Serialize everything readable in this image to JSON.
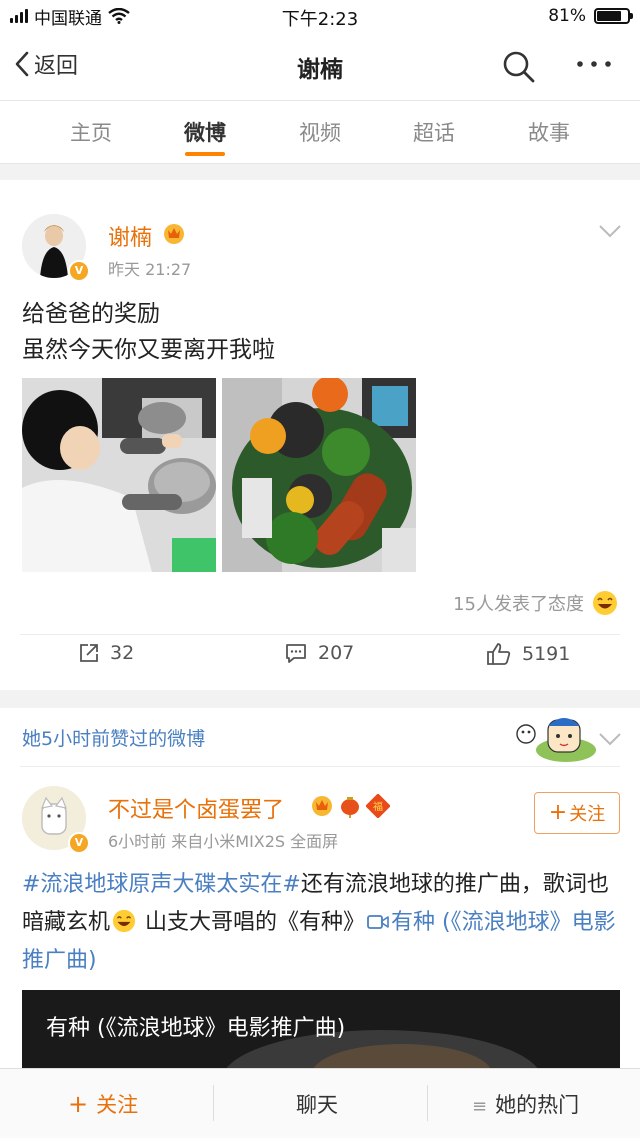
{
  "status_bar": {
    "carrier": "中国联通",
    "time": "下午2:23",
    "battery": "81%",
    "battery_level": 0.81
  },
  "nav": {
    "back_label": "返回",
    "title": "谢楠"
  },
  "tabs": [
    {
      "label": "主页"
    },
    {
      "label": "微博"
    },
    {
      "label": "视频"
    },
    {
      "label": "超话"
    },
    {
      "label": "故事"
    }
  ],
  "post1": {
    "username": "谢楠",
    "time": "昨天 21:27",
    "content_line1": "给爸爸的奖励",
    "content_line2": "虽然今天你又要离开我啦",
    "reaction_text": "15人发表了态度",
    "reposts": "32",
    "comments": "207",
    "likes": "5191"
  },
  "post2": {
    "liked_header": "她5小时前赞过的微博",
    "username": "不过是个卤蛋罢了",
    "meta": "6小时前  来自小米MIX2S 全面屏",
    "follow_label": "关注",
    "hashtag": "#流浪地球原声大碟太实在#",
    "text_a": "还有流浪地球的推广曲，歌词也暗藏玄机",
    "text_b": " 山支大哥唱的《有种》",
    "video_link": "有种 (《流浪地球》电影推广曲)",
    "video_title": "有种 (《流浪地球》电影推广曲)"
  },
  "bottom_bar": {
    "follow": "关注",
    "chat": "聊天",
    "hot": "她的热门"
  },
  "colors": {
    "accent": "#ff8200",
    "username": "#e8710a",
    "link": "#4a7fc1"
  }
}
